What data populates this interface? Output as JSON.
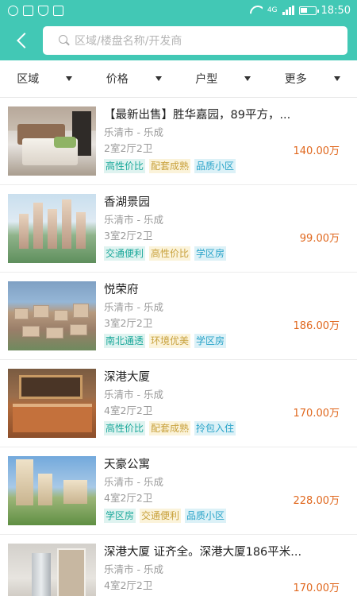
{
  "status_bar": {
    "time": "18:50",
    "net": "4G"
  },
  "search": {
    "placeholder": "区域/楼盘名称/开发商"
  },
  "filters": [
    {
      "label": "区域"
    },
    {
      "label": "价格"
    },
    {
      "label": "户型"
    },
    {
      "label": "更多"
    }
  ],
  "colors": {
    "brand": "#42c8b5",
    "price": "#e0671d"
  },
  "listings": [
    {
      "title": "【最新出售】胜华嘉园，89平方，...",
      "location": "乐清市 - 乐成",
      "layout": "2室2厅2卫",
      "price": "140.00万",
      "tags": [
        {
          "text": "高性价比",
          "style": "teal"
        },
        {
          "text": "配套成熟",
          "style": "yellow"
        },
        {
          "text": "品质小区",
          "style": "blue"
        }
      ]
    },
    {
      "title": "香湖景园",
      "location": "乐清市 - 乐成",
      "layout": "3室2厅2卫",
      "price": "99.00万",
      "tags": [
        {
          "text": "交通便利",
          "style": "teal"
        },
        {
          "text": "高性价比",
          "style": "yellow"
        },
        {
          "text": "学区房",
          "style": "blue"
        }
      ]
    },
    {
      "title": "悦荣府",
      "location": "乐清市 - 乐成",
      "layout": "3室2厅2卫",
      "price": "186.00万",
      "tags": [
        {
          "text": "南北通透",
          "style": "teal"
        },
        {
          "text": "环境优美",
          "style": "yellow"
        },
        {
          "text": "学区房",
          "style": "blue"
        }
      ]
    },
    {
      "title": "深港大厦",
      "location": "乐清市 - 乐成",
      "layout": "4室2厅2卫",
      "price": "170.00万",
      "tags": [
        {
          "text": "高性价比",
          "style": "teal"
        },
        {
          "text": "配套成熟",
          "style": "yellow"
        },
        {
          "text": "拎包入住",
          "style": "blue"
        }
      ]
    },
    {
      "title": "天豪公寓",
      "location": "乐清市 - 乐成",
      "layout": "4室2厅2卫",
      "price": "228.00万",
      "tags": [
        {
          "text": "学区房",
          "style": "teal"
        },
        {
          "text": "交通便利",
          "style": "yellow"
        },
        {
          "text": "品质小区",
          "style": "blue"
        }
      ]
    },
    {
      "title": "深港大厦 证齐全。深港大厦186平米...",
      "location": "乐清市 - 乐成",
      "layout": "4室2厅2卫",
      "price": "170.00万",
      "tags": []
    }
  ]
}
